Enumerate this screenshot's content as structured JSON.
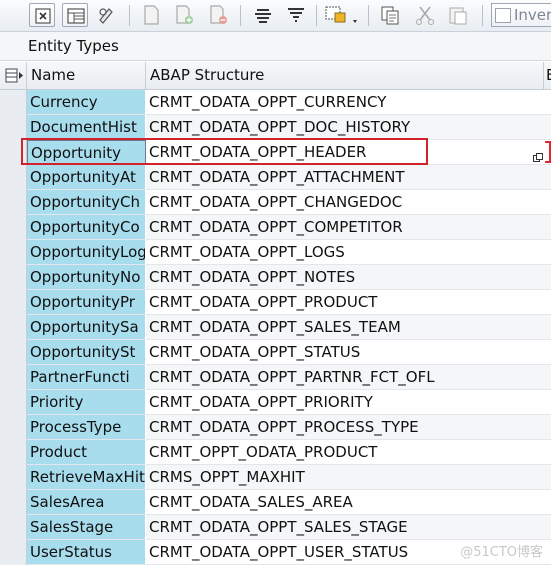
{
  "toolbar": {
    "buttons": [
      {
        "icon": "details-icon"
      },
      {
        "icon": "table-view-icon"
      },
      {
        "icon": "edit-pencil-icon"
      },
      {
        "icon": "new-document-icon"
      },
      {
        "icon": "insert-row-icon"
      },
      {
        "icon": "delete-row-icon"
      },
      {
        "icon": "sort-ascending-icon"
      },
      {
        "icon": "filter-icon"
      },
      {
        "icon": "select-block-icon"
      },
      {
        "icon": "copy-icon"
      },
      {
        "icon": "cut-icon"
      },
      {
        "icon": "paste-icon"
      }
    ],
    "invert_label": "Inver"
  },
  "panel": {
    "title": "Entity Types"
  },
  "grid": {
    "columns": [
      "Name",
      "ABAP Structure",
      "E"
    ],
    "current_row_index": 2,
    "rows": [
      {
        "name": "Currency",
        "abap": "CRMT_ODATA_OPPT_CURRENCY"
      },
      {
        "name": "DocumentHist",
        "abap": "CRMT_ODATA_OPPT_DOC_HISTORY"
      },
      {
        "name": "Opportunity",
        "abap": "CRMT_ODATA_OPPT_HEADER"
      },
      {
        "name": "OpportunityAt",
        "abap": "CRMT_ODATA_OPPT_ATTACHMENT"
      },
      {
        "name": "OpportunityCh",
        "abap": "CRMT_ODATA_OPPT_CHANGEDOC"
      },
      {
        "name": "OpportunityCo",
        "abap": "CRMT_ODATA_OPPT_COMPETITOR"
      },
      {
        "name": "OpportunityLog",
        "abap": "CRMT_ODATA_OPPT_LOGS"
      },
      {
        "name": "OpportunityNo",
        "abap": "CRMT_ODATA_OPPT_NOTES"
      },
      {
        "name": "OpportunityPr",
        "abap": "CRMT_ODATA_OPPT_PRODUCT"
      },
      {
        "name": "OpportunitySa",
        "abap": "CRMT_ODATA_OPPT_SALES_TEAM"
      },
      {
        "name": "OpportunitySt",
        "abap": "CRMT_ODATA_OPPT_STATUS"
      },
      {
        "name": "PartnerFuncti",
        "abap": "CRMT_ODATA_OPPT_PARTNR_FCT_OFL"
      },
      {
        "name": "Priority",
        "abap": "CRMT_ODATA_OPPT_PRIORITY"
      },
      {
        "name": "ProcessType",
        "abap": "CRMT_ODATA_OPPT_PROCESS_TYPE"
      },
      {
        "name": "Product",
        "abap": "CRMT_OPPT_ODATA_PRODUCT"
      },
      {
        "name": "RetrieveMaxHit",
        "abap": "CRMS_OPPT_MAXHIT"
      },
      {
        "name": "SalesArea",
        "abap": "CRMT_ODATA_SALES_AREA"
      },
      {
        "name": "SalesStage",
        "abap": "CRMT_ODATA_OPPT_SALES_STAGE"
      },
      {
        "name": "UserStatus",
        "abap": "CRMT_ODATA_OPPT_USER_STATUS"
      }
    ]
  },
  "watermark": "@51CTO博客",
  "colors": {
    "name_column_bg": "#a8ddee",
    "highlight_border": "#d2232a"
  }
}
